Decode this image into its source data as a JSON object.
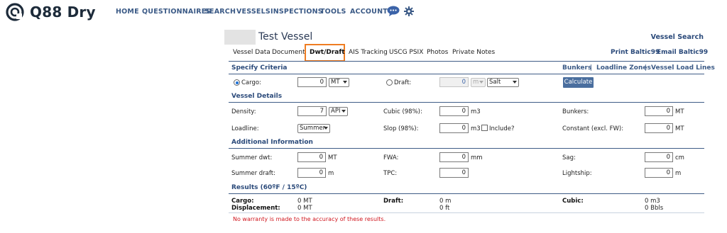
{
  "header": {
    "brand": "Q88 Dry",
    "nav": [
      "HOME",
      "QUESTIONNAIRES",
      "SEARCH",
      "VESSELS",
      "INSPECTIONS",
      "TOOLS",
      "ACCOUNT"
    ],
    "icons": [
      "chat-icon",
      "gear-icon"
    ]
  },
  "vessel": {
    "title": "Test Vessel",
    "search_link": "Vessel Search"
  },
  "tabs": {
    "items": [
      "Vessel Data",
      "Documents",
      "Dwt/Draft",
      "AIS Tracking",
      "USCG PSIX",
      "Photos",
      "Private Notes"
    ],
    "active": "Dwt/Draft"
  },
  "print_links": [
    "Print Baltic99",
    "Email Baltic99"
  ],
  "criteria": {
    "heading": "Specify Criteria",
    "links": [
      "Bunkers",
      "Loadline Zones",
      "Vessel Load Lines"
    ],
    "separator": "|",
    "cargo_label": "Cargo:",
    "cargo_value": "0",
    "cargo_unit": "MT",
    "draft_label": "Draft:",
    "draft_value": "0",
    "draft_unit": "m",
    "water": "Salt",
    "button": "Calculate"
  },
  "details": {
    "heading": "Vessel Details",
    "density_label": "Density:",
    "density_value": "7",
    "density_unit": "API",
    "cubic_label": "Cubic (98%):",
    "cubic_value": "0",
    "cubic_unit": "m3",
    "bunkers_label": "Bunkers:",
    "bunkers_value": "0",
    "bunkers_unit": "MT",
    "loadline_label": "Loadline:",
    "loadline_value": "Summer",
    "slop_label": "Slop (98%):",
    "slop_value": "0",
    "slop_unit": "m3",
    "include_label": "Include?",
    "constant_label": "Constant (excl. FW):",
    "constant_value": "0",
    "constant_unit": "MT"
  },
  "additional": {
    "heading": "Additional Information",
    "summer_dwt_label": "Summer dwt:",
    "summer_dwt_value": "0",
    "summer_dwt_unit": "MT",
    "fwa_label": "FWA:",
    "fwa_value": "0",
    "fwa_unit": "mm",
    "sag_label": "Sag:",
    "sag_value": "0",
    "sag_unit": "cm",
    "summer_draft_label": "Summer draft:",
    "summer_draft_value": "0",
    "summer_draft_unit": "m",
    "tpc_label": "TPC:",
    "tpc_value": "0",
    "lightship_label": "Lightship:",
    "lightship_value": "0",
    "lightship_unit": "m"
  },
  "results": {
    "heading": "Results (60ºF / 15ºC)",
    "cargo_label": "Cargo:",
    "cargo_value": "0 MT",
    "displacement_label": "Displacement:",
    "displacement_value": "0 MT",
    "draft_label": "Draft:",
    "draft_m": "0 m",
    "draft_ft": "0 ft",
    "cubic_label": "Cubic:",
    "cubic_m3": "0 m3",
    "cubic_bbls": "0 Bbls"
  },
  "warning": "No warranty is made to the accuracy of these results."
}
